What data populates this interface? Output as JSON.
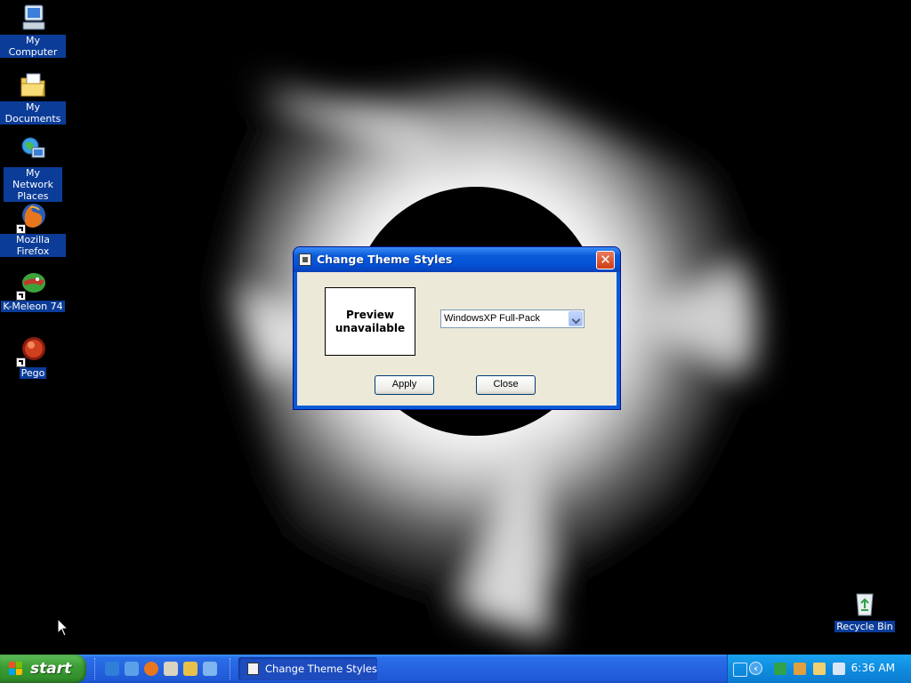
{
  "desktop": {
    "icons": [
      {
        "label": "My Computer",
        "icon": "my-computer-icon"
      },
      {
        "label": "My Documents",
        "icon": "my-documents-icon"
      },
      {
        "label": "My Network Places",
        "icon": "network-places-icon"
      },
      {
        "label": "Mozilla Firefox",
        "icon": "firefox-icon"
      },
      {
        "label": "K-Meleon 74",
        "icon": "k-meleon-icon"
      },
      {
        "label": "Pego",
        "icon": "pego-icon"
      },
      {
        "label": "Recycle Bin",
        "icon": "recycle-bin-icon"
      }
    ]
  },
  "dialog": {
    "title": "Change Theme Styles",
    "preview_text": "Preview unavailable",
    "theme_select_value": "WindowsXP Full-Pack",
    "apply_label": "Apply",
    "close_label": "Close"
  },
  "taskbar": {
    "start_label": "start",
    "task_label": "Change Theme Styles",
    "clock": "6:36 AM",
    "tray_expand": "‹"
  },
  "colors": {
    "title_bar": "#0a5ad8",
    "window_face": "#ece9d8",
    "taskbar": "#2663e0",
    "start_button": "#3c9e34",
    "icon_label_bg": "#0b3c98"
  }
}
